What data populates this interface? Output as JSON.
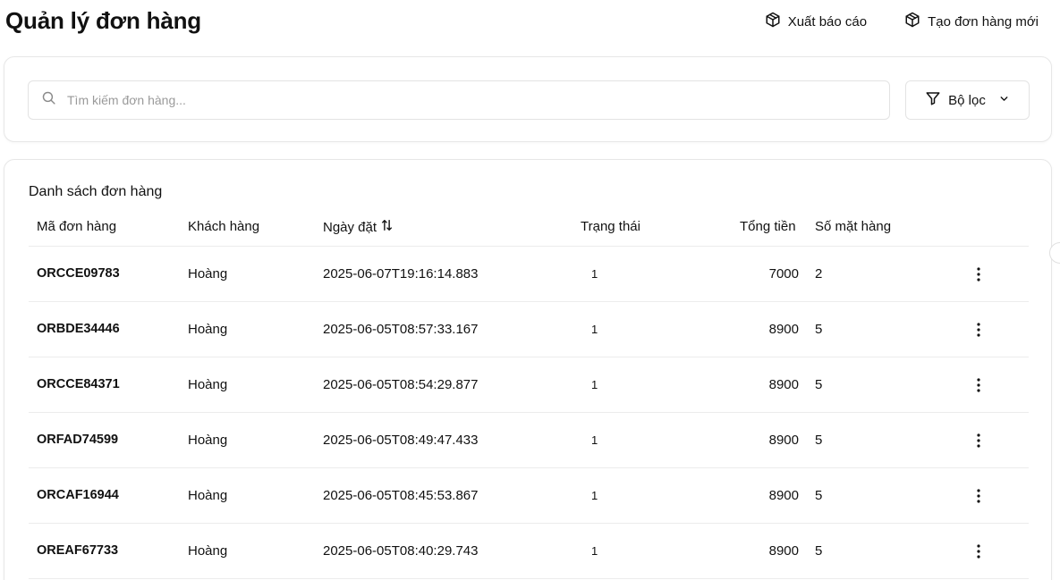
{
  "page": {
    "title": "Quản lý đơn hàng"
  },
  "header": {
    "export_label": "Xuất báo cáo",
    "create_label": "Tạo đơn hàng mới"
  },
  "search": {
    "placeholder": "Tìm kiếm đơn hàng...",
    "value": ""
  },
  "filter": {
    "label": "Bộ lọc"
  },
  "orders": {
    "title": "Danh sách đơn hàng",
    "columns": {
      "code": "Mã đơn hàng",
      "customer": "Khách hàng",
      "date": "Ngày đặt",
      "status": "Trạng thái",
      "total": "Tổng tiền",
      "items": "Số mặt hàng"
    },
    "rows": [
      {
        "code": "ORCCE09783",
        "customer": "Hoàng",
        "date": "2025-06-07T19:16:14.883",
        "status": "1",
        "total": "7000",
        "items": "2"
      },
      {
        "code": "ORBDE34446",
        "customer": "Hoàng",
        "date": "2025-06-05T08:57:33.167",
        "status": "1",
        "total": "8900",
        "items": "5"
      },
      {
        "code": "ORCCE84371",
        "customer": "Hoàng",
        "date": "2025-06-05T08:54:29.877",
        "status": "1",
        "total": "8900",
        "items": "5"
      },
      {
        "code": "ORFAD74599",
        "customer": "Hoàng",
        "date": "2025-06-05T08:49:47.433",
        "status": "1",
        "total": "8900",
        "items": "5"
      },
      {
        "code": "ORCAF16944",
        "customer": "Hoàng",
        "date": "2025-06-05T08:45:53.867",
        "status": "1",
        "total": "8900",
        "items": "5"
      },
      {
        "code": "OREAF67733",
        "customer": "Hoàng",
        "date": "2025-06-05T08:40:29.743",
        "status": "1",
        "total": "8900",
        "items": "5"
      }
    ]
  },
  "icons": {
    "export": "box-icon",
    "create": "box-icon",
    "search": "search-icon",
    "filter": "funnel-icon",
    "dropdown": "chevron-down-icon",
    "sort": "sort-arrows-icon",
    "row_action": "more-vertical-icon"
  }
}
